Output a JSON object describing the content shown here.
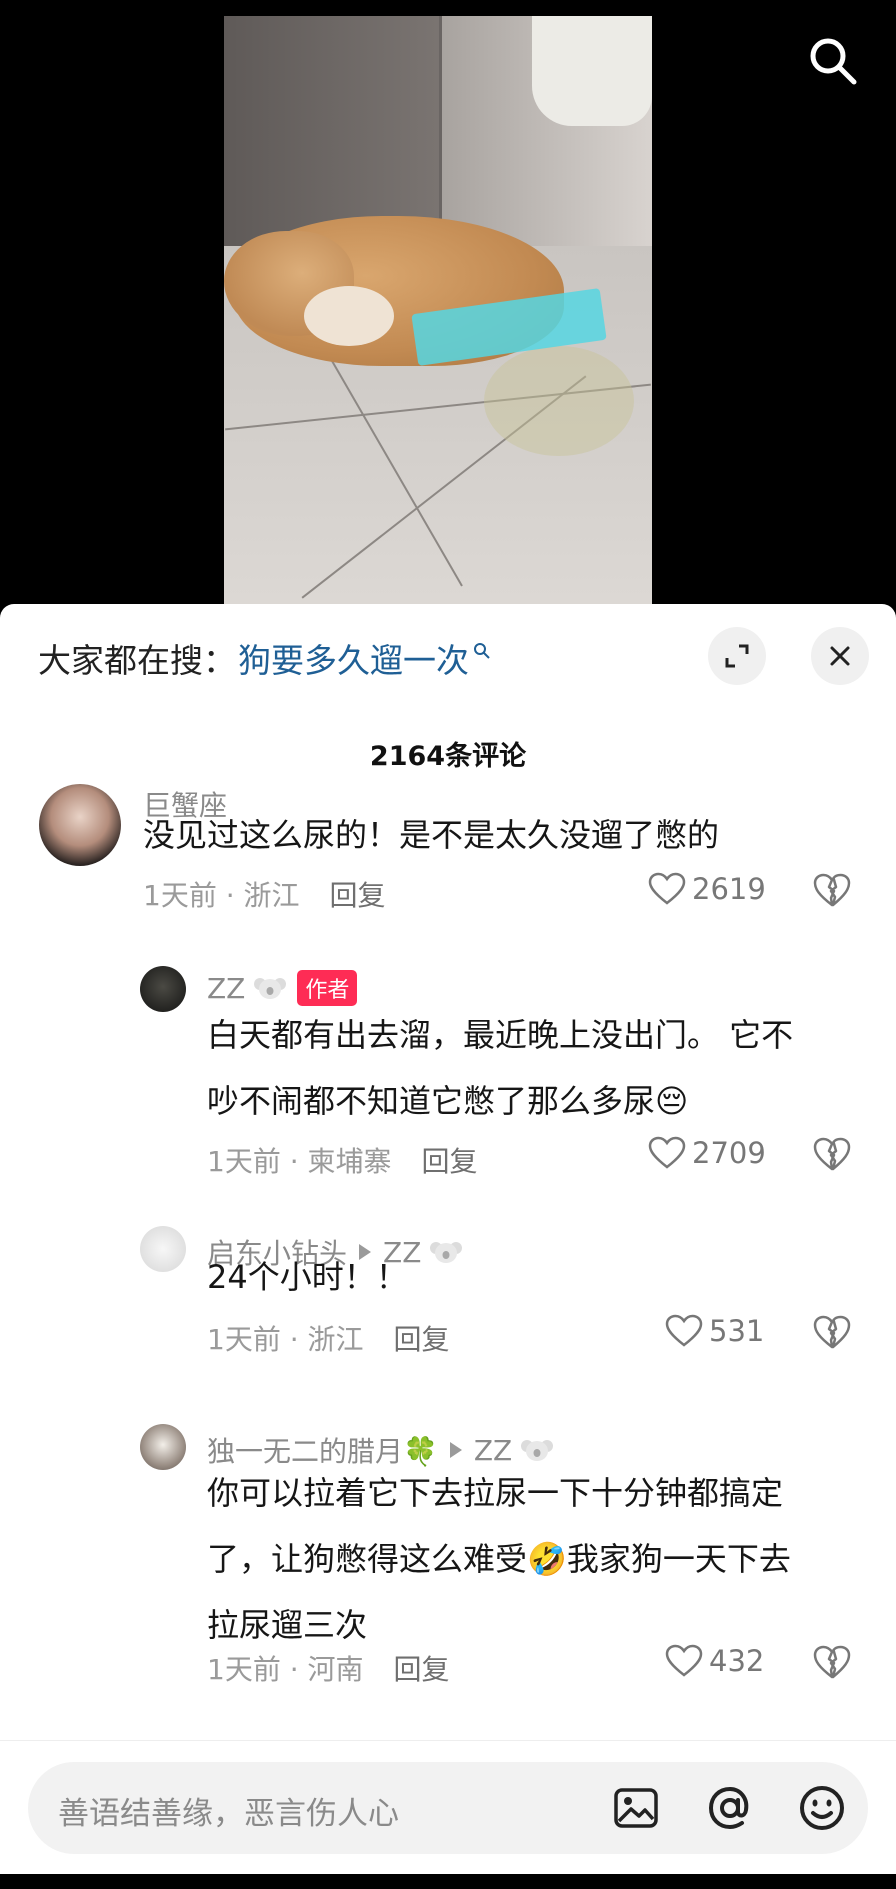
{
  "hot_search": {
    "prefix": "大家都在搜：",
    "term": "狗要多久遛一次"
  },
  "comment_count_label": "2164条评论",
  "comments": [
    {
      "user": "巨蟹座",
      "text": "没见过这么尿的！是不是太久没遛了憋的",
      "time": "1天前 · 浙江",
      "reply": "回复",
      "likes": "2619"
    },
    {
      "user": "ZZ",
      "badge": "作者",
      "text_line1": "白天都有出去溜，最近晚上没出门。 它不",
      "text_line2": "吵不闹都不知道它憋了那么多尿😔",
      "time": "1天前 · 柬埔寨",
      "reply": "回复",
      "likes": "2709"
    },
    {
      "user": "启东小钻头",
      "to": "ZZ",
      "text": "24个小时！！",
      "time": "1天前 · 浙江",
      "reply": "回复",
      "likes": "531"
    },
    {
      "user": "独一无二的腊月🍀",
      "to": "ZZ",
      "text_line1": "你可以拉着它下去拉尿一下十分钟都搞定",
      "text_line2": "了，让狗憋得这么难受🤣我家狗一天下去",
      "text_line3": "拉尿遛三次",
      "time": "1天前 · 河南",
      "reply": "回复",
      "likes": "432"
    }
  ],
  "input": {
    "placeholder": "善语结善缘，恶言伤人心"
  },
  "icons": [
    "search-icon",
    "expand-icon",
    "close-icon",
    "heart-icon",
    "broken-heart-icon",
    "koala-icon",
    "image-icon",
    "at-icon",
    "emoji-icon"
  ],
  "colors": {
    "accent": "#fe2c55",
    "link": "#1f5f95"
  }
}
